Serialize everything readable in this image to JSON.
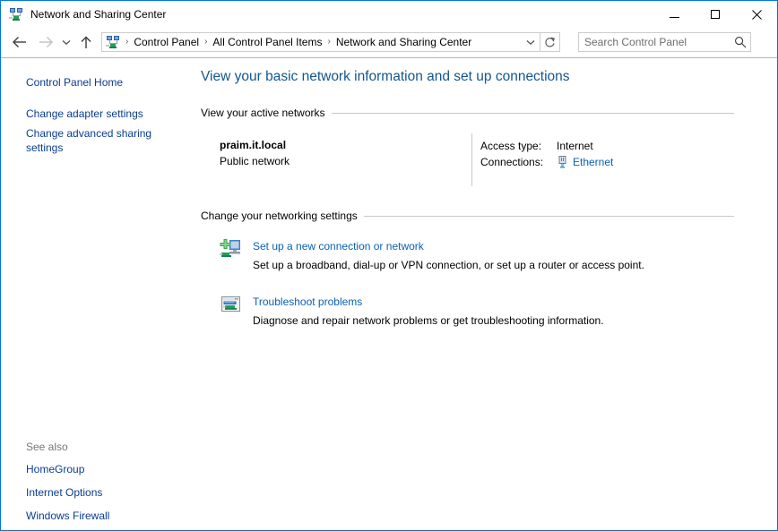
{
  "window": {
    "title": "Network and Sharing Center",
    "title_icon": "network-icon",
    "controls": {
      "minimize": "Minimize",
      "maximize": "Maximize",
      "close": "Close"
    }
  },
  "addressbar": {
    "back": "Back",
    "forward": "Forward",
    "recent": "Recent locations",
    "up": "Up one level",
    "crumb_icon": "network-icon",
    "breadcrumbs": [
      "Control Panel",
      "All Control Panel Items",
      "Network and Sharing Center"
    ],
    "separator": "›",
    "dropdown": "Previous locations",
    "refresh": "Refresh",
    "search": {
      "placeholder": "Search Control Panel",
      "value": "",
      "icon": "search-icon"
    }
  },
  "sidebar": {
    "links": [
      {
        "label": "Control Panel Home"
      },
      {
        "label": "Change adapter settings"
      },
      {
        "label": "Change advanced sharing settings"
      }
    ],
    "see_also": {
      "label": "See also",
      "links": [
        {
          "label": "HomeGroup"
        },
        {
          "label": "Internet Options"
        },
        {
          "label": "Windows Firewall"
        }
      ]
    }
  },
  "main": {
    "page_title": "View your basic network information and set up connections",
    "active_networks": {
      "section_title": "View your active networks",
      "network_name": "praim.it.local",
      "network_type": "Public network",
      "access_type_label": "Access type:",
      "access_type_value": "Internet",
      "connections_label": "Connections:",
      "connection_name": "Ethernet",
      "connection_icon": "ethernet-icon"
    },
    "networking_settings": {
      "section_title": "Change your networking settings",
      "items": [
        {
          "icon": "new-connection-icon",
          "link": "Set up a new connection or network",
          "description": "Set up a broadband, dial-up or VPN connection, or set up a router or access point."
        },
        {
          "icon": "troubleshoot-icon",
          "link": "Troubleshoot problems",
          "description": "Diagnose and repair network problems or get troubleshooting information."
        }
      ]
    }
  },
  "colors": {
    "window_border": "#0078d7",
    "heading": "#14568c",
    "link": "#0a5fb4",
    "sidebar_link": "#0a3d8f",
    "muted": "#777777",
    "rule": "#c8c8c8"
  }
}
